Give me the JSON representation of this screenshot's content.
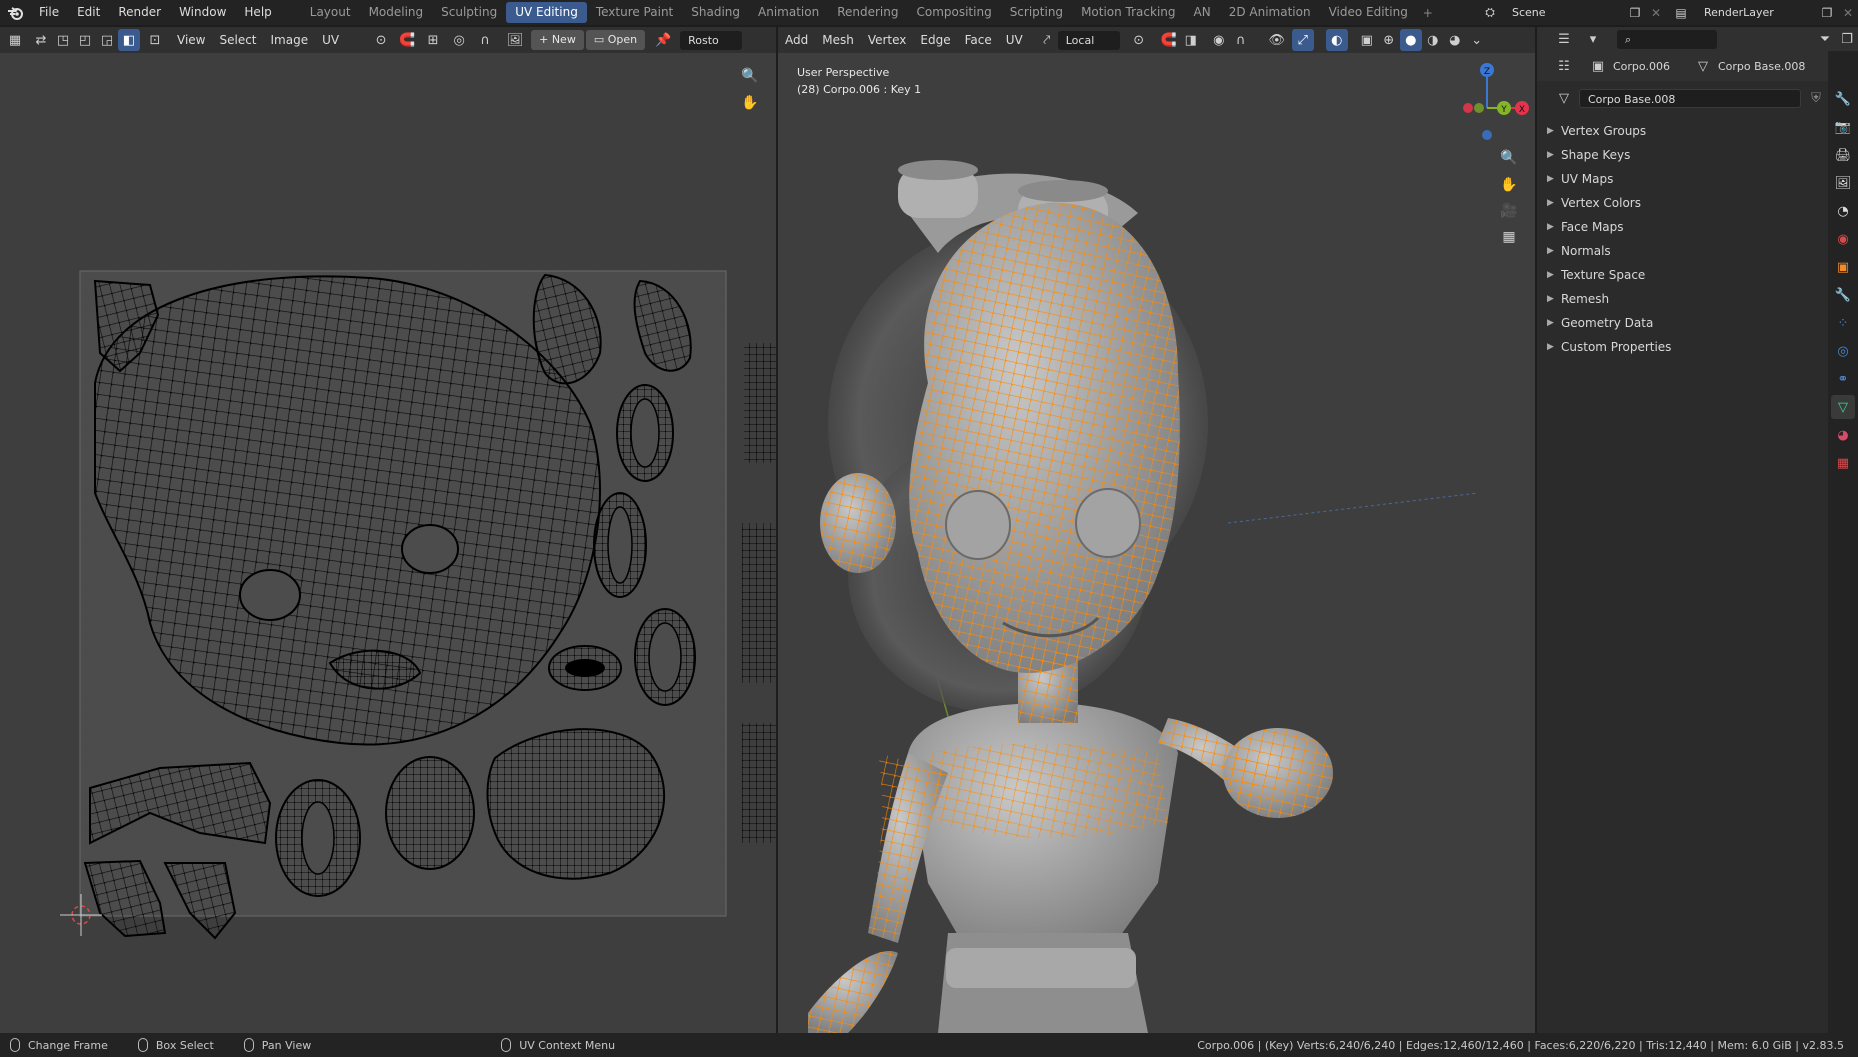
{
  "topbar": {
    "menus": [
      "File",
      "Edit",
      "Render",
      "Window",
      "Help"
    ],
    "workspaces": [
      "Layout",
      "Modeling",
      "Sculpting",
      "UV Editing",
      "Texture Paint",
      "Shading",
      "Animation",
      "Rendering",
      "Compositing",
      "Scripting",
      "Motion Tracking",
      "AN",
      "2D Animation",
      "Video Editing"
    ],
    "active_workspace": "UV Editing",
    "scene": "Scene",
    "view_layer": "RenderLayer"
  },
  "uv_editor": {
    "menus": [
      "View",
      "Select",
      "Image",
      "UV"
    ],
    "new_label": "New",
    "open_label": "Open",
    "image_name": "Rosto"
  },
  "viewport": {
    "menus": [
      "Add",
      "Mesh",
      "Vertex",
      "Edge",
      "Face",
      "UV"
    ],
    "transform_orientation": "Local",
    "overlay_title": "User Perspective",
    "overlay_subtitle": "(28) Corpo.006 : Key 1",
    "gizmo_axes": {
      "x": "X",
      "y": "Y",
      "z": "Z"
    },
    "colors": {
      "x": "#e4344d",
      "y": "#83b526",
      "z": "#3a78d6",
      "selection": "#ff8a00"
    }
  },
  "properties": {
    "object_name": "Corpo.006",
    "mesh_name": "Corpo Base.008",
    "datablock_field": "Corpo Base.008",
    "panels": [
      "Vertex Groups",
      "Shape Keys",
      "UV Maps",
      "Vertex Colors",
      "Face Maps",
      "Normals",
      "Texture Space",
      "Remesh",
      "Geometry Data",
      "Custom Properties"
    ]
  },
  "statusbar": {
    "left_action": "Change Frame",
    "middle_action": "Box Select",
    "right_action": "Pan View",
    "context_action": "UV Context Menu",
    "stats": "Corpo.006 | (Key) Verts:6,240/6,240 | Edges:12,460/12,460 | Faces:6,220/6,220 | Tris:12,440 | Mem: 6.0 GiB | v2.83.5"
  }
}
